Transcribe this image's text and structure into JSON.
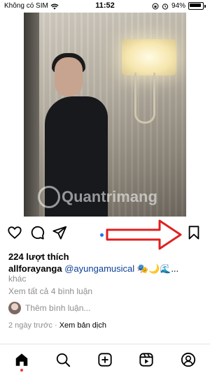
{
  "status_bar": {
    "carrier": "Không có SIM",
    "time": "11:52",
    "battery": "94%"
  },
  "post": {
    "watermark": "Quantrimang",
    "likes": "224 lượt thích",
    "username": "allforayanga",
    "caption_mention": "@ayungamusical",
    "caption_emojis": "🎭🌙🌊...",
    "more_label": "khác",
    "view_comments": "Xem tất cả 4 bình luận",
    "comment_placeholder": "Thêm bình luận...",
    "time_ago": "2 ngày trước",
    "translate": "Xem bản dịch"
  },
  "colors": {
    "accent_blue": "#1877f2",
    "arrow_red": "#e02020",
    "text_secondary": "#8e8e8e"
  },
  "icons": {
    "like": "heart-icon",
    "comment": "comment-icon",
    "share": "send-icon",
    "save": "bookmark-icon",
    "home": "home-icon",
    "search": "search-icon",
    "create": "plus-square-icon",
    "reels": "reels-icon",
    "profile": "profile-icon"
  }
}
